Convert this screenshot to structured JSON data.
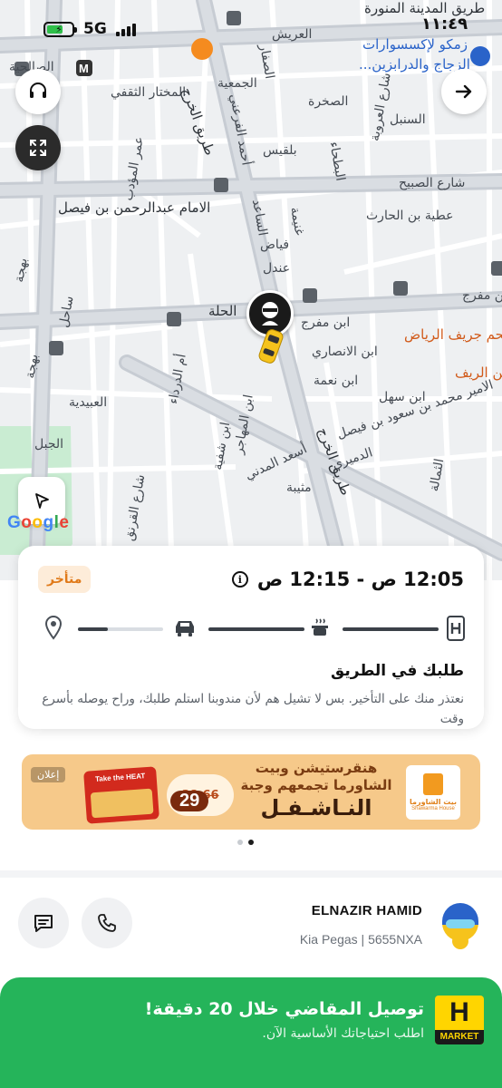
{
  "status_bar": {
    "network": "5G",
    "time": "١١:٤٩"
  },
  "map": {
    "labels": [
      "طريق المدينة المنورة",
      "العريش",
      "الصفار",
      "زمكو لإكسسوارات",
      "الزجاج والدرابزين...",
      "الصالحية",
      "المختار الثقفي",
      "الجمعية",
      "أحمد الفرعني",
      "الصخرة",
      "شارع العروبة",
      "السنبل",
      "بلقيس",
      "عمر المؤدب",
      "البطحاء",
      "شارع الصبيح",
      "الامام عبدالرحمن بن فيصل",
      "طريق الخرج",
      "الساعد",
      "غنيمة",
      "عطية بن الحارث",
      "فياض",
      "عندل",
      "بهجة",
      "ساحل",
      "الحلة",
      "ابن مفرج",
      "ابن مفرج",
      "ابن الانصاري",
      "لحم جريف الرياض",
      "بهجة",
      "أم الدرداء",
      "ابن نعمة",
      "ابن الريف",
      "العبيدية",
      "ابن المهاجر",
      "ابن سهل",
      "الامير محمد بن سعود بن فيصل",
      "ابن شفية",
      "أسعد المدني",
      "الدميري",
      "الجبل",
      "شارع القرنق",
      "مثيبة",
      "طريق الخرج",
      "الثمالة"
    ],
    "google": "Google"
  },
  "order": {
    "time_range": "12:05 ص - 12:15 ص",
    "late_badge": "متأخر",
    "status_title": "طلبك في الطريق",
    "status_desc": "نعتذر منك على التأخير. بس لا تشيل هم لأن مندوبنا استلم طلبك، وراح يوصله بأسرع وقت",
    "progress": {
      "steps": [
        "restaurant",
        "preparing",
        "on-the-way",
        "delivered"
      ],
      "current_step_fill": 0.35
    }
  },
  "ad": {
    "line1": "هنقرستيشن وبيت",
    "line2": "الشاورما تجمعهم وجبة",
    "line3": "النـاشـفـل",
    "old_price": "38.66",
    "new_price": "29",
    "tag": "إعلان",
    "logo_ar": "بيت الشاورما",
    "logo_en": "Shawarma House",
    "box_label": "Take the HEAT",
    "dots": 2,
    "active_dot": 1
  },
  "driver": {
    "name": "ELNAZIR HAMID",
    "car": "Kia Pegas | 5655NXA"
  },
  "market_banner": {
    "logo_letter": "H",
    "logo_text": "MARKET",
    "title": "توصيل المقاضي خلال 20 دقيقة!",
    "subtitle": "اطلب احتياجاتك الأساسية الآن."
  },
  "colors": {
    "accent_green": "#25b45a",
    "late_orange": "#e07a1a",
    "taxi_yellow": "#f6c31c"
  }
}
